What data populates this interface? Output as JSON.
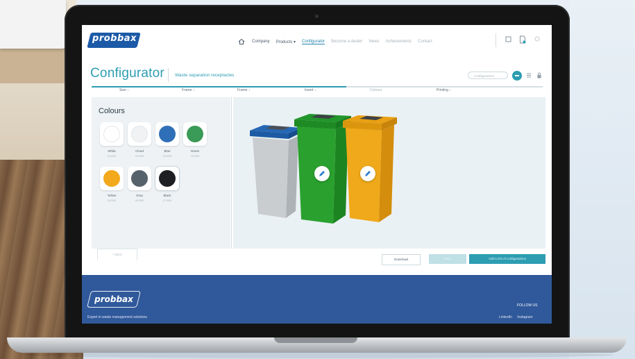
{
  "brand": {
    "name": "probbax",
    "color": "#1c5aa7"
  },
  "nav": {
    "links": [
      {
        "label": "Company"
      },
      {
        "label": "Products ▾"
      },
      {
        "label": "Configurator",
        "active": true
      },
      {
        "label": "Become a dealer"
      },
      {
        "label": "News"
      },
      {
        "label": "Achievements"
      },
      {
        "label": "Contact"
      }
    ]
  },
  "configurator": {
    "title": "Configurator",
    "subtitle": "Waste separation receptacles",
    "search_placeholder": "Configurations",
    "accent_color": "#2d9db2",
    "steps": [
      {
        "label": "Size ↓"
      },
      {
        "label": "Frame ↓"
      },
      {
        "label": "Frame ↓"
      },
      {
        "label": "Insert ↓"
      },
      {
        "label": "Colours"
      },
      {
        "label": "Printing ↓"
      }
    ]
  },
  "colours": {
    "title": "Colours",
    "options": [
      {
        "name": "White",
        "code": "01.0000",
        "hex": "#ffffff"
      },
      {
        "name": "Cloud",
        "code": "02.0000",
        "hex": "#f0f2f3"
      },
      {
        "name": "Blue",
        "code": "03.0000",
        "hex": "#2f6fb7"
      },
      {
        "name": "Green",
        "code": "04.0000",
        "hex": "#3a9a57"
      },
      {
        "name": "Yellow",
        "code": "05.0000",
        "hex": "#f2a91c"
      },
      {
        "name": "Grey",
        "code": "06.0000",
        "hex": "#55626c"
      },
      {
        "name": "Black",
        "code": "07.0000",
        "hex": "#1d1f22",
        "selected": true
      }
    ]
  },
  "bins": [
    {
      "body": "#c9cdd0",
      "lid": "#2567b5"
    },
    {
      "body": "#2aa12e",
      "lid": "#1f8a24"
    },
    {
      "body": "#f0a91a",
      "lid": "#e09a0e"
    }
  ],
  "actions": {
    "back": "< Back",
    "download": "Download",
    "save": "Save",
    "add_to_list": "Add to list of configurations"
  },
  "footer": {
    "logo": "probbax",
    "tagline": "Expert in waste management solutions",
    "follow": "FOLLOW US",
    "social": [
      "LinkedIn",
      "Instagram"
    ]
  }
}
